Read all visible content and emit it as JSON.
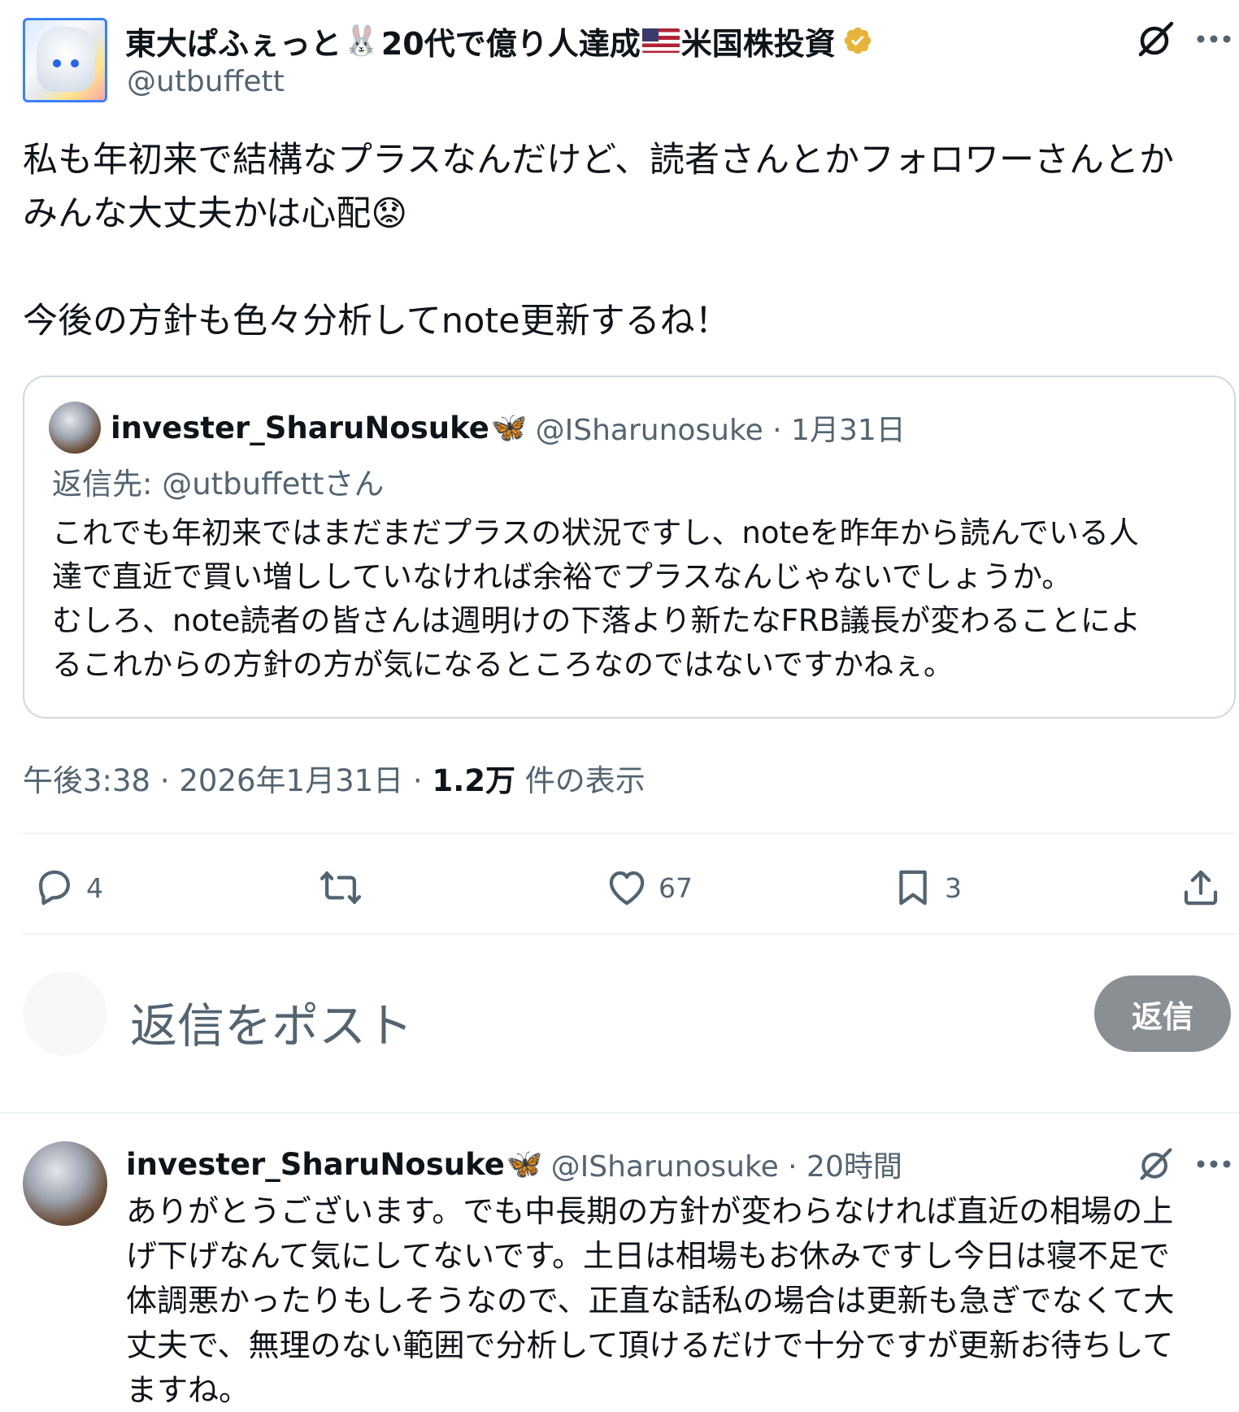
{
  "tweet": {
    "author": {
      "name_part1": "東大ぱふぇっと",
      "name_emoji1": "🐰",
      "name_part2": "20代で億り人達成",
      "name_part3": "米国株投資",
      "handle": "@utbuffett"
    },
    "text_lines": [
      "私も年初来で結構なプラスなんだけど、読者さんとかフォロワーさんとか",
      "みんな大丈夫かは心配",
      "今後の方針も色々分析してnote更新するね！"
    ],
    "text_emoji": "😟",
    "quote": {
      "author_name": "invester_SharuNosuke",
      "author_emoji": "🦋",
      "handle_date": "@ISharunosuke · 1月31日",
      "reply_to": "返信先: @utbuffettさん",
      "lines": [
        "これでも年初来ではまだまだプラスの状況ですし、noteを昨年から読んでいる人",
        "達で直近で買い増ししていなければ余裕でプラスなんじゃないでしょうか。",
        "むしろ、note読者の皆さんは週明けの下落より新たなFRB議長が変わることによ",
        "るこれからの方針の方が気になるところなのではないですかねぇ。"
      ]
    },
    "meta": {
      "time_date": "午後3:38 · 2026年1月31日 · ",
      "views": "1.2万",
      "views_label": " 件の表示"
    },
    "actions": {
      "replies": "4",
      "likes": "67",
      "bookmarks": "3"
    }
  },
  "composer": {
    "placeholder": "返信をポスト",
    "button_label": "返信"
  },
  "reply": {
    "author_name": "invester_SharuNosuke",
    "author_emoji": "🦋",
    "handle_time": "@ISharunosuke · 20時間",
    "lines": [
      "ありがとうございます。でも中長期の方針が変わらなければ直近の相場の上",
      "げ下げなんて気にしてないです。土日は相場もお休みですし今日は寝不足で",
      "体調悪かったりもしそうなので、正直な話私の場合は更新も急ぎでなくて大",
      "丈夫で、無理のない範囲で分析して頂けるだけで十分ですが更新お待ちして",
      "ますね。"
    ]
  },
  "colors": {
    "text": "#0f1419",
    "secondary": "#536471",
    "border": "#cfd9de",
    "reply_button": "#8a8f94",
    "verified": "#e8b339"
  },
  "icons": [
    "grok-icon",
    "more-icon",
    "reply-icon",
    "retweet-icon",
    "like-icon",
    "bookmark-icon",
    "share-icon",
    "verified-badge-icon"
  ]
}
